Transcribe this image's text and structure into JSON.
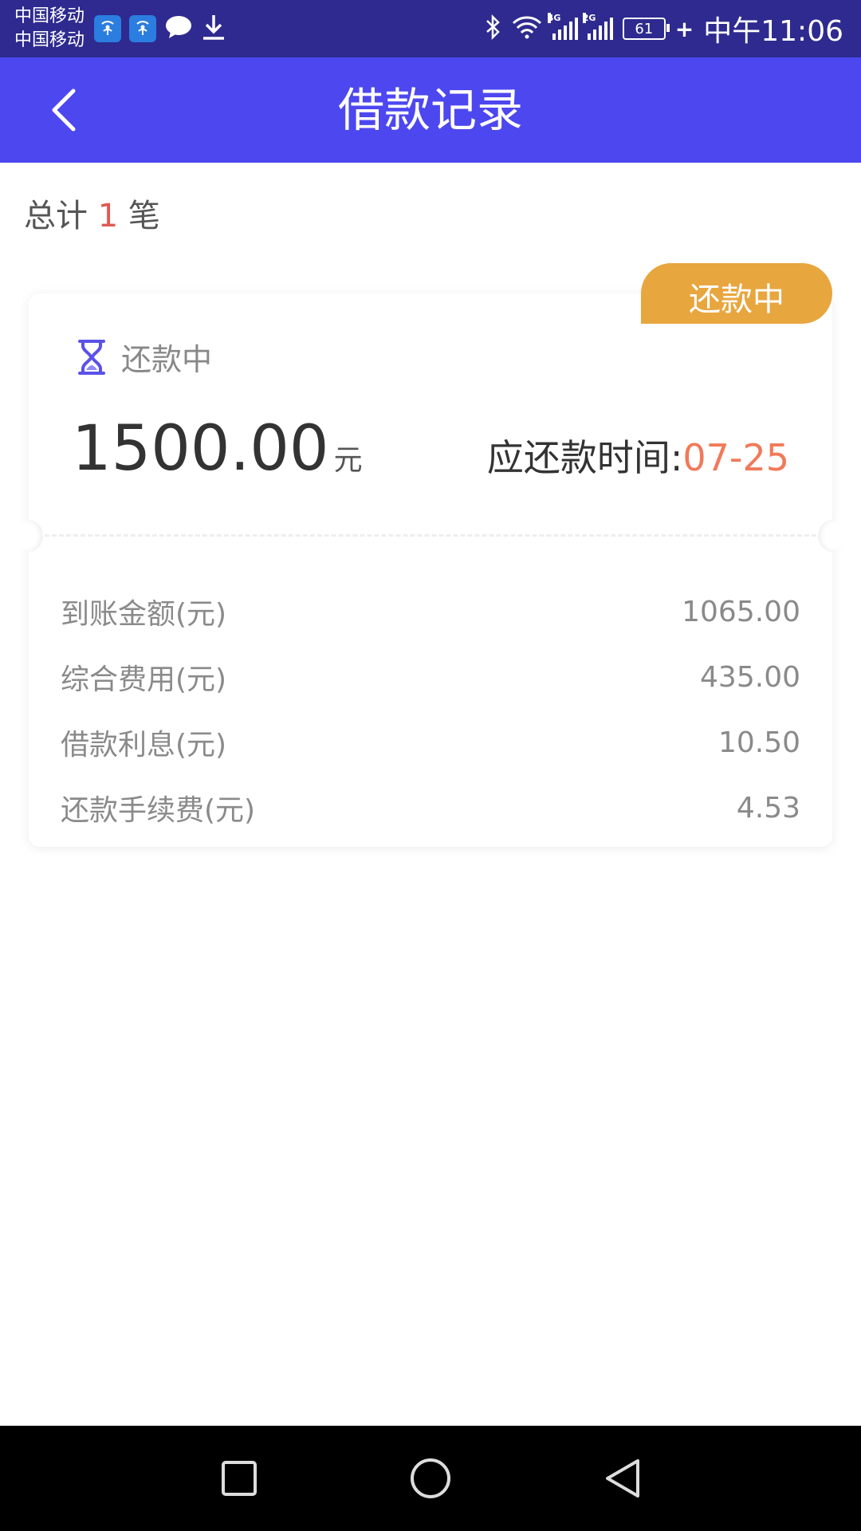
{
  "status_bar": {
    "carrier_1": "中国移动",
    "carrier_2": "中国移动",
    "network_1": "4G",
    "network_2": "2G",
    "battery": "61",
    "time": "中午11:06"
  },
  "header": {
    "title": "借款记录"
  },
  "summary": {
    "prefix": "总计",
    "count": "1",
    "suffix": "笔"
  },
  "loan": {
    "badge": "还款中",
    "status": "还款中",
    "amount": "1500.00",
    "amount_unit": "元",
    "due_label": "应还款时间:",
    "due_date": "07-25",
    "details": [
      {
        "label": "到账金额(元)",
        "value": "1065.00"
      },
      {
        "label": "综合费用(元)",
        "value": "435.00"
      },
      {
        "label": "借款利息(元)",
        "value": "10.50"
      },
      {
        "label": "还款手续费(元)",
        "value": "4.53"
      }
    ]
  },
  "colors": {
    "header_bg": "#4d47f0",
    "status_bar_bg": "#2e2a8f",
    "badge_bg": "#e8a63f",
    "due_date": "#f07a5a",
    "count": "#e05a50"
  },
  "icons": {
    "back": "chevron-left-icon",
    "status": "hourglass-icon",
    "nav_recent": "square-icon",
    "nav_home": "circle-icon",
    "nav_back": "triangle-back-icon"
  }
}
